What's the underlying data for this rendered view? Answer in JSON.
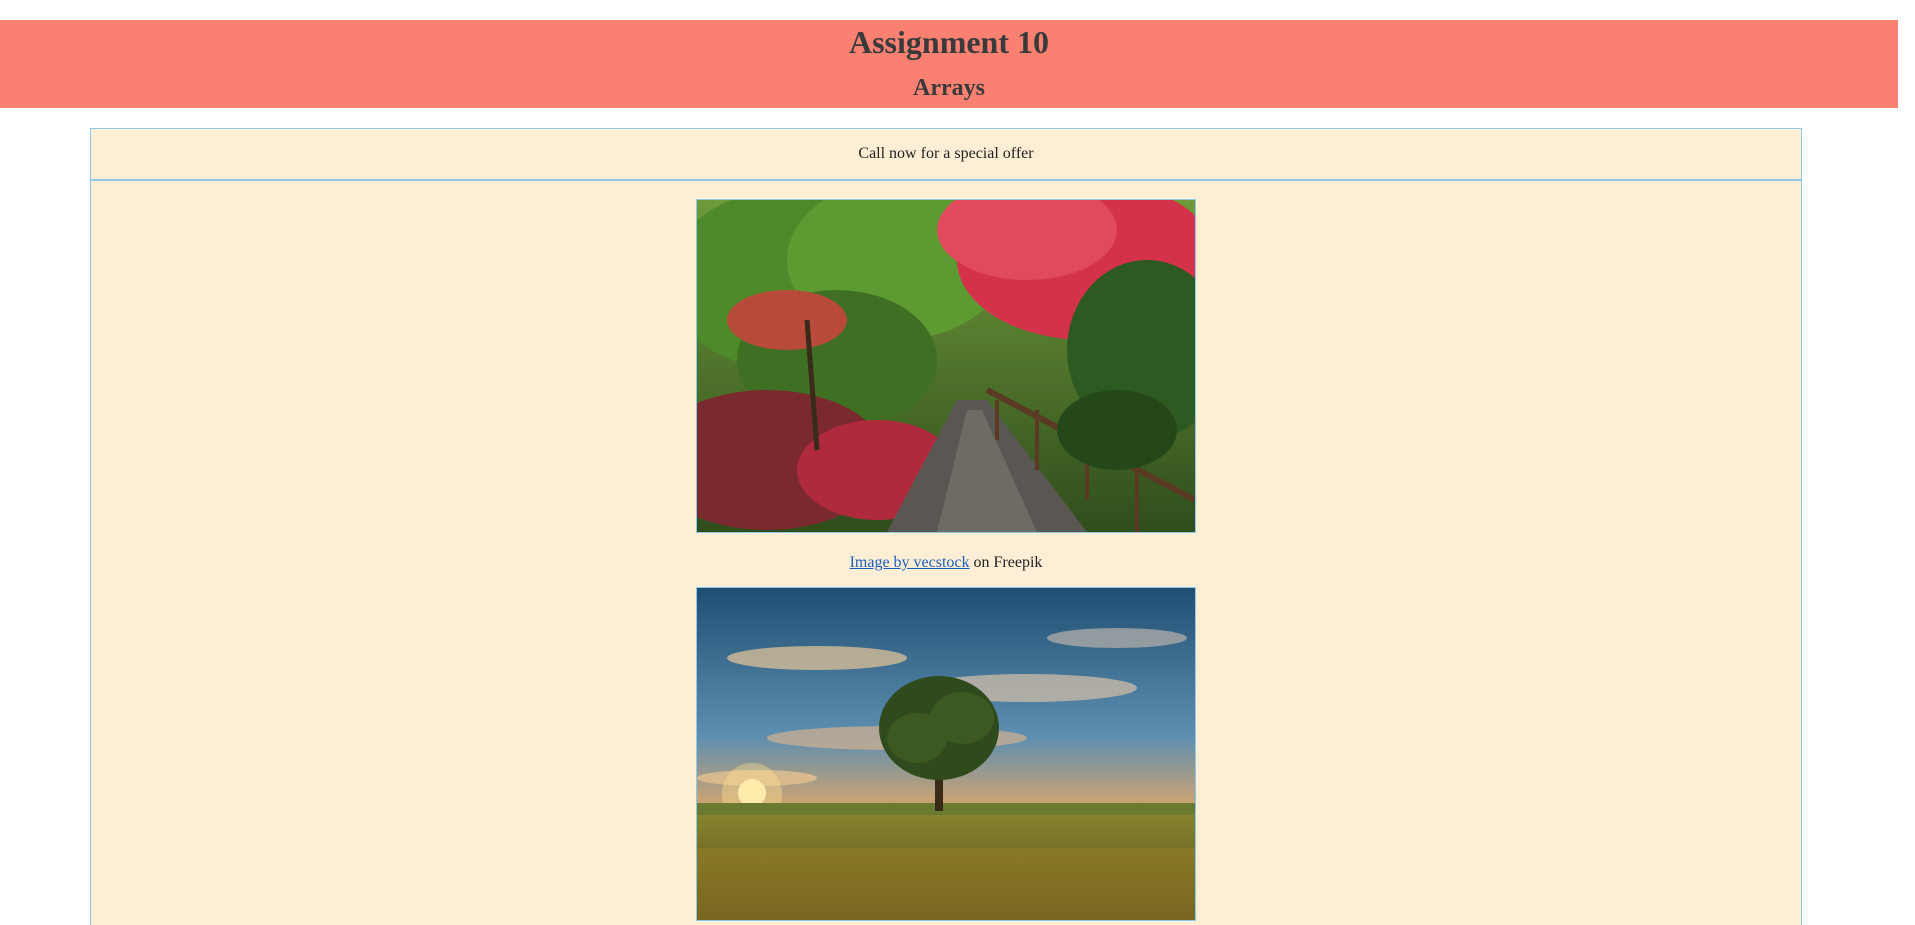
{
  "header": {
    "title": "Assignment 10",
    "subtitle": "Arrays"
  },
  "offer": {
    "text": "Call now for a special offer"
  },
  "gallery": {
    "images": [
      {
        "caption_link": "Image by vecstock",
        "caption_suffix": " on Freepik"
      },
      {
        "caption_link": "",
        "caption_suffix": ""
      }
    ]
  },
  "colors": {
    "header_bg": "#fa8072",
    "content_bg": "#ffeed6",
    "border": "#8ec9e6",
    "link": "#1a5fbf"
  },
  "scrollbar": {
    "up_icon": "chevron-up-icon",
    "down_icon": "chevron-down-icon"
  }
}
